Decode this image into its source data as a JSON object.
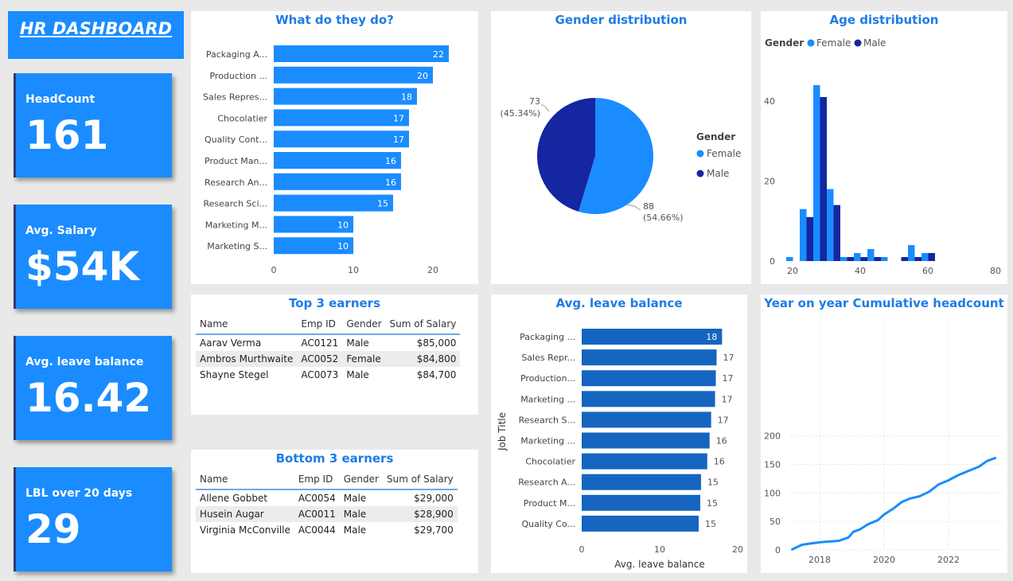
{
  "header": {
    "title": "HR DASHBOARD"
  },
  "kpis": [
    {
      "label": "HeadCount",
      "value": "161"
    },
    {
      "label": "Avg. Salary",
      "value": "$54K"
    },
    {
      "label": "Avg. leave balance",
      "value": "16.42"
    },
    {
      "label": "LBL over 20 days",
      "value": "29"
    }
  ],
  "tables": {
    "top": {
      "title": "Top 3 earners",
      "headers": [
        "Name",
        "Emp ID",
        "Gender",
        "Sum of Salary"
      ],
      "rows": [
        [
          "Aarav Verma",
          "AC0121",
          "Male",
          "$85,000"
        ],
        [
          "Ambros Murthwaite",
          "AC0052",
          "Female",
          "$84,800"
        ],
        [
          "Shayne Stegel",
          "AC0073",
          "Male",
          "$84,700"
        ]
      ]
    },
    "bottom": {
      "title": "Bottom 3 earners",
      "headers": [
        "Name",
        "Emp ID",
        "Gender",
        "Sum of Salary"
      ],
      "rows": [
        [
          "Allene Gobbet",
          "AC0054",
          "Male",
          "$29,000"
        ],
        [
          "Husein Augar",
          "AC0011",
          "Male",
          "$28,900"
        ],
        [
          "Virginia McConville",
          "AC0044",
          "Male",
          "$29,700"
        ]
      ]
    }
  },
  "colors": {
    "accent": "#1a8cff",
    "female": "#1a8cff",
    "male": "#1426a0",
    "leave_bar": "#1565c0",
    "title": "#1e7be6"
  },
  "chart_data": [
    {
      "id": "jobs",
      "type": "bar",
      "title": "What do they do?",
      "orientation": "horizontal",
      "categories": [
        "Packaging A...",
        "Production ...",
        "Sales Repres...",
        "Chocolatier",
        "Quality Cont...",
        "Product Man...",
        "Research An...",
        "Research Sci...",
        "Marketing M...",
        "Marketing S..."
      ],
      "values": [
        22,
        20,
        18,
        17,
        17,
        16,
        16,
        15,
        10,
        10
      ],
      "xticks": [
        0,
        10,
        20
      ],
      "xlim": [
        0,
        23
      ],
      "data_labels": true
    },
    {
      "id": "gender",
      "type": "pie",
      "title": "Gender distribution",
      "legend_title": "Gender",
      "legend_position": "right",
      "slices": [
        {
          "name": "Female",
          "value": 88,
          "label": "88",
          "pct_label": "(54.66%)"
        },
        {
          "name": "Male",
          "value": 73,
          "label": "73",
          "pct_label": "(45.34%)"
        }
      ]
    },
    {
      "id": "age",
      "type": "bar",
      "title": "Age distribution",
      "legend_title": "Gender",
      "legend_position": "top-left",
      "xticks": [
        20,
        40,
        60,
        80
      ],
      "yticks": [
        0,
        20,
        40
      ],
      "xlim": [
        17,
        82
      ],
      "ylim": [
        0,
        50
      ],
      "x": [
        20,
        24,
        28,
        32,
        36,
        40,
        44,
        48,
        52,
        56,
        60,
        64
      ],
      "series": [
        {
          "name": "Female",
          "values": [
            1,
            13,
            44,
            18,
            1,
            2,
            3,
            1,
            0,
            4,
            2,
            0
          ]
        },
        {
          "name": "Male",
          "values": [
            0,
            11,
            41,
            14,
            1,
            1,
            1,
            0,
            1,
            1,
            2,
            0
          ]
        }
      ]
    },
    {
      "id": "leave",
      "type": "bar",
      "title": "Avg. leave balance",
      "orientation": "horizontal",
      "xlabel": "Avg. leave balance",
      "ylabel": "Job Title",
      "categories": [
        "Packaging ...",
        "Sales Repr...",
        "Production...",
        "Marketing ...",
        "Research S...",
        "Marketing ...",
        "Chocolatier",
        "Research A...",
        "Product M...",
        "Quality Co..."
      ],
      "values": [
        18,
        17.3,
        17.2,
        17.1,
        16.6,
        16.4,
        16.1,
        15.3,
        15.2,
        15.0
      ],
      "data_labels": [
        "18",
        "17",
        "17",
        "17",
        "17",
        "16",
        "16",
        "15",
        "15",
        "15"
      ],
      "xticks": [
        0,
        10,
        20
      ],
      "xlim": [
        0,
        20
      ]
    },
    {
      "id": "cumulative",
      "type": "line",
      "title": "Year on year Cumulative headcount",
      "xticks": [
        "2018",
        "2020",
        "2022"
      ],
      "yticks": [
        0,
        50,
        100,
        150,
        200
      ],
      "ylim": [
        0,
        200
      ],
      "grid": true,
      "x": [
        2017.15,
        2017.45,
        2017.8,
        2018.1,
        2018.6,
        2018.9,
        2019.05,
        2019.25,
        2019.5,
        2019.8,
        2020.0,
        2020.3,
        2020.55,
        2020.8,
        2021.1,
        2021.4,
        2021.7,
        2022.0,
        2022.3,
        2022.6,
        2022.95,
        2023.2,
        2023.45
      ],
      "y": [
        1,
        9,
        12,
        14,
        16,
        22,
        32,
        36,
        45,
        52,
        62,
        73,
        84,
        90,
        94,
        102,
        115,
        122,
        131,
        138,
        146,
        156,
        161
      ]
    }
  ]
}
